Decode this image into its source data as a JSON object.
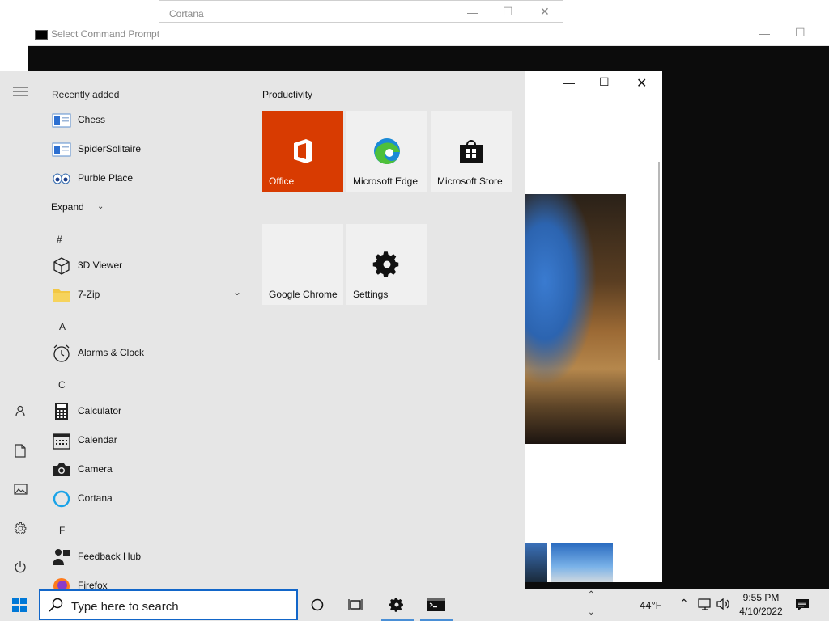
{
  "background_windows": {
    "cortana": {
      "title": "Cortana"
    },
    "cmd": {
      "title": "Select Command Prompt"
    }
  },
  "start_menu": {
    "recently_added_title": "Recently added",
    "recent_apps": [
      {
        "label": "Chess",
        "icon": "chess-icon"
      },
      {
        "label": "SpiderSolitaire",
        "icon": "spider-solitaire-icon"
      },
      {
        "label": "Purble Place",
        "icon": "purble-place-icon"
      }
    ],
    "expand_label": "Expand",
    "sections": {
      "hash": "#",
      "a": "A",
      "c": "C",
      "f": "F"
    },
    "apps": {
      "viewer3d": "3D Viewer",
      "zip7": "7-Zip",
      "alarms": "Alarms & Clock",
      "calculator": "Calculator",
      "calendar": "Calendar",
      "camera": "Camera",
      "cortana": "Cortana",
      "feedback": "Feedback Hub",
      "firefox": "Firefox"
    },
    "tiles_group_title": "Productivity",
    "tiles": {
      "office": "Office",
      "edge": "Microsoft Edge",
      "store": "Microsoft Store",
      "chrome": "Google Chrome",
      "settings": "Settings"
    },
    "colors": {
      "office_tile": "#d83b01",
      "accent": "#0078d7"
    }
  },
  "taskbar": {
    "search_placeholder": "Type here to search",
    "weather": "44°F",
    "time": "9:55 PM",
    "date": "4/10/2022"
  }
}
